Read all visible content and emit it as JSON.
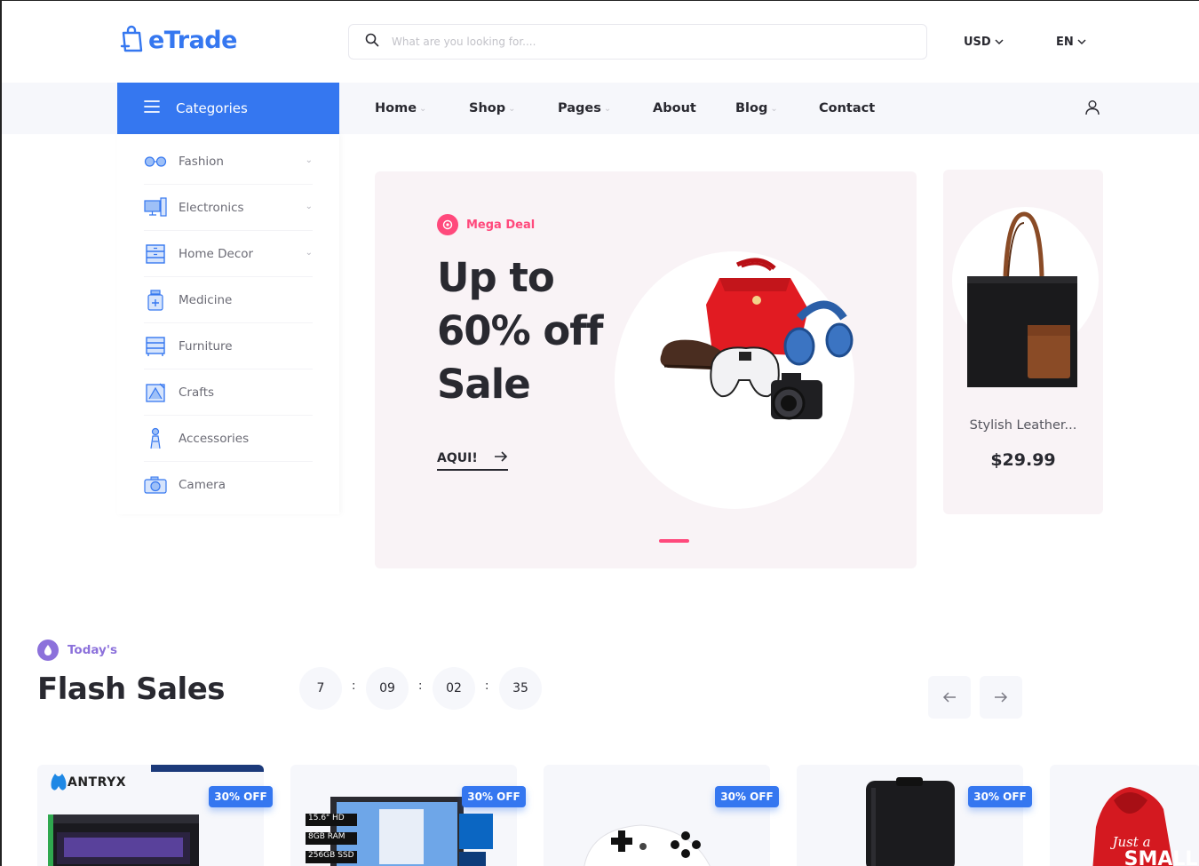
{
  "header": {
    "logo_text": "eTrade",
    "search_placeholder": "What are you looking for....",
    "currency": "USD",
    "language": "EN"
  },
  "nav": {
    "categories_label": "Categories",
    "items": [
      {
        "label": "Home",
        "has_dropdown": true
      },
      {
        "label": "Shop",
        "has_dropdown": true
      },
      {
        "label": "Pages",
        "has_dropdown": true
      },
      {
        "label": "About",
        "has_dropdown": false
      },
      {
        "label": "Blog",
        "has_dropdown": true
      },
      {
        "label": "Contact",
        "has_dropdown": false
      }
    ]
  },
  "sidebar": {
    "items": [
      {
        "label": "Fashion",
        "icon": "glasses-icon",
        "has_dropdown": true
      },
      {
        "label": "Electronics",
        "icon": "computer-icon",
        "has_dropdown": true
      },
      {
        "label": "Home Decor",
        "icon": "cabinet-icon",
        "has_dropdown": true
      },
      {
        "label": "Medicine",
        "icon": "medicine-bottle-icon",
        "has_dropdown": false
      },
      {
        "label": "Furniture",
        "icon": "furniture-icon",
        "has_dropdown": false
      },
      {
        "label": "Crafts",
        "icon": "crafts-icon",
        "has_dropdown": false
      },
      {
        "label": "Accessories",
        "icon": "accessories-icon",
        "has_dropdown": false
      },
      {
        "label": "Camera",
        "icon": "camera-icon",
        "has_dropdown": false
      }
    ]
  },
  "hero": {
    "tag": "Mega Deal",
    "title": "Up to\n60% off\nSale",
    "link_label": "AQUI!"
  },
  "side_product": {
    "name": "Stylish Leather...",
    "price": "$29.99"
  },
  "flash_sales": {
    "tag": "Today's",
    "title": "Flash Sales",
    "countdown": {
      "days": "7",
      "hours": "09",
      "minutes": "02",
      "seconds": "35"
    },
    "separator": ":",
    "products": [
      {
        "badge": "30% OFF",
        "brand": "ANTRYX"
      },
      {
        "badge": "30% OFF",
        "specs": [
          "15.6\" HD",
          "8GB RAM",
          "256GB SSD"
        ]
      },
      {
        "badge": "30% OFF"
      },
      {
        "badge": "30% OFF"
      }
    ]
  },
  "colors": {
    "primary": "#3577f0",
    "accent_pink": "#ff497c",
    "accent_purple": "#8c71db",
    "text_dark": "#292930"
  }
}
